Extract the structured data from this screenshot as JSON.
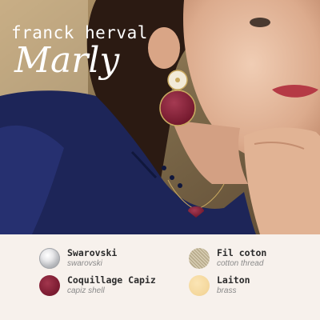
{
  "brand": "franck herval",
  "collection": "Marly",
  "colors": {
    "background": "#f7f1ec",
    "capiz": "#7e1d33",
    "brass": "#f5d99f",
    "blouse": "#1f2a5e"
  },
  "materials": [
    {
      "name": "Swarovski",
      "subtitle": "swarovski",
      "swatch": "crystal-swatch"
    },
    {
      "name": "Fil coton",
      "subtitle": "cotton thread",
      "swatch": "cotton-thread-swatch"
    },
    {
      "name": "Coquillage Capiz",
      "subtitle": "capiz shell",
      "swatch": "capiz-shell-swatch"
    },
    {
      "name": "Laiton",
      "subtitle": "brass",
      "swatch": "brass-swatch"
    }
  ]
}
